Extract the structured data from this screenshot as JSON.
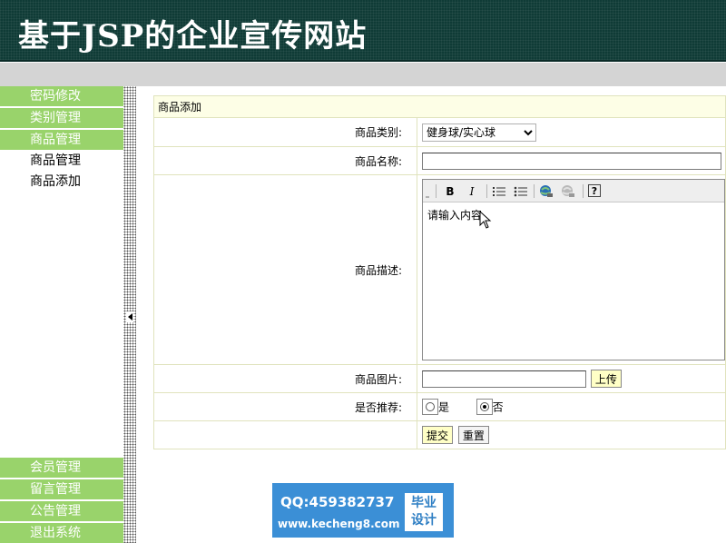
{
  "header": {
    "title": "基于JSP的企业宣传网站"
  },
  "sidebar": {
    "top_items": [
      "密码修改",
      "类别管理",
      "商品管理"
    ],
    "sub_items": [
      "商品管理",
      "商品添加"
    ],
    "bottom_items": [
      "会员管理",
      "留言管理",
      "公告管理",
      "退出系统"
    ]
  },
  "form": {
    "caption": "商品添加",
    "category_label": "商品类别:",
    "category_selected": "健身球/实心球",
    "name_label": "商品名称:",
    "name_value": "",
    "desc_label": "商品描述:",
    "desc_text": "请输入内容",
    "image_label": "商品图片:",
    "upload_label": "上传",
    "recommend_label": "是否推荐:",
    "radio_yes": "是",
    "radio_no": "否",
    "submit_label": "提交",
    "reset_label": "重置"
  },
  "editor_toolbar": {
    "bold_label": "B",
    "italic_label": "I",
    "help_label": "?"
  },
  "watermark": {
    "qq": "QQ:459382737",
    "url": "www.kecheng8.com",
    "badge_line1": "毕业",
    "badge_line2": "设计"
  }
}
